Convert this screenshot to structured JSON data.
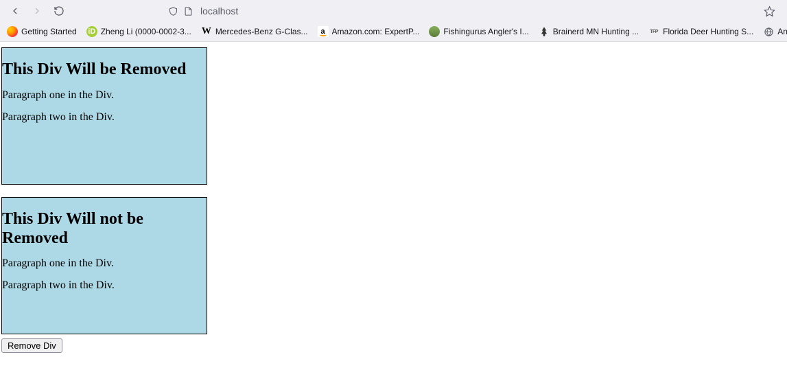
{
  "browser": {
    "url": "localhost",
    "bookmarks": [
      {
        "label": "Getting Started",
        "icon": "ff"
      },
      {
        "label": "Zheng Li (0000-0002-3...",
        "icon": "orcid",
        "iconText": "iD"
      },
      {
        "label": "Mercedes-Benz G-Clas...",
        "icon": "wiki",
        "iconText": "W"
      },
      {
        "label": "Amazon.com: ExpertP...",
        "icon": "amazon",
        "iconText": "a"
      },
      {
        "label": "Fishingurus Angler's I...",
        "icon": "fish"
      },
      {
        "label": "Brainerd MN Hunting ...",
        "icon": "tree",
        "iconText": "✳"
      },
      {
        "label": "Florida Deer Hunting S...",
        "icon": "tfp",
        "iconText": "TFP"
      },
      {
        "label": "Another r",
        "icon": "globe"
      }
    ]
  },
  "page": {
    "box1": {
      "heading": "This Div Will be Removed",
      "p1": "Paragraph one in the Div.",
      "p2": "Paragraph two in the Div."
    },
    "box2": {
      "heading": "This Div Will not be Removed",
      "p1": "Paragraph one in the Div.",
      "p2": "Paragraph two in the Div."
    },
    "button_label": "Remove Div"
  }
}
